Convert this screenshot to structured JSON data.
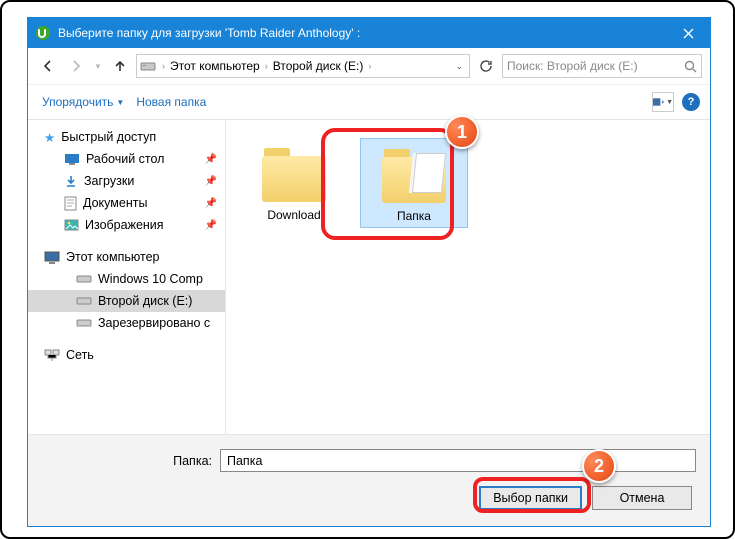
{
  "window": {
    "title": "Выберите папку для загрузки 'Tomb Raider Anthology' :"
  },
  "breadcrumb": {
    "root": "Этот компьютер",
    "drive": "Второй диск (E:)"
  },
  "search": {
    "placeholder": "Поиск: Второй диск (E:)"
  },
  "toolbar": {
    "organize": "Упорядочить",
    "new_folder": "Новая папка"
  },
  "tree": {
    "quick_access": "Быстрый доступ",
    "desktop": "Рабочий стол",
    "downloads": "Загрузки",
    "documents": "Документы",
    "pictures": "Изображения",
    "this_pc": "Этот компьютер",
    "win10": "Windows 10 Comp",
    "drive_e": "Второй диск (E:)",
    "reserved": "Зарезервировано с",
    "network": "Сеть"
  },
  "content": {
    "items": [
      {
        "label": "Download"
      },
      {
        "label": "Папка"
      }
    ]
  },
  "footer": {
    "field_label": "Папка:",
    "field_value": "Папка",
    "select": "Выбор папки",
    "cancel": "Отмена"
  },
  "callouts": {
    "one": "1",
    "two": "2"
  }
}
